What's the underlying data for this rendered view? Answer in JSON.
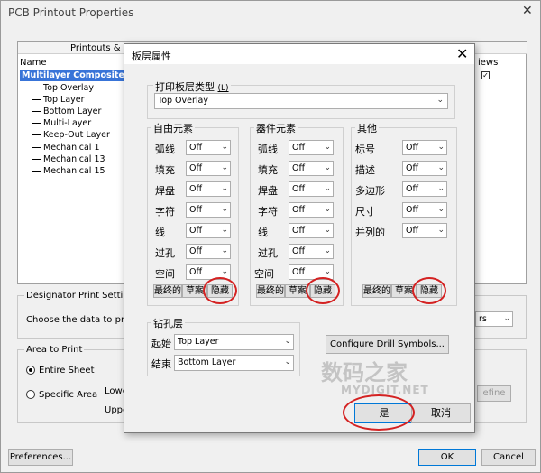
{
  "background_window": {
    "title": "PCB Printout Properties",
    "tree": {
      "col_printouts": "Printouts & Lay",
      "col_name": "Name",
      "col_views": "iews",
      "root": "Multilayer Composite Pr",
      "items": [
        "Top Overlay",
        "Top Layer",
        "Bottom Layer",
        "Multi-Layer",
        "Keep-Out Layer",
        "Mechanical 1",
        "Mechanical 13",
        "Mechanical 15"
      ]
    },
    "designator_group": "Designator Print Settings",
    "choose_label": "Choose the data to print",
    "right_select_fragment": "rs",
    "area_group": "Area to Print",
    "radio_entire": "Entire Sheet",
    "radio_specific": "Specific Area",
    "lower_label": "Lower",
    "upper_label": "Uppe",
    "define_button": "efine",
    "preferences_button": "Preferences...",
    "ok_button": "OK",
    "cancel_button": "Cancel"
  },
  "dialog": {
    "title": "板层属性",
    "layer_type_group": "打印板层类型",
    "layer_type_hotkey": "(L)",
    "layer_type_value": "Top Overlay",
    "free_group": "自由元素",
    "component_group": "器件元素",
    "other_group": "其他",
    "free_rows": [
      {
        "label": "弧线",
        "value": "Off"
      },
      {
        "label": "填充",
        "value": "Off"
      },
      {
        "label": "焊盘",
        "value": "Off"
      },
      {
        "label": "字符",
        "value": "Off"
      },
      {
        "label": "线",
        "value": "Off"
      },
      {
        "label": "过孔",
        "value": "Off"
      },
      {
        "label": "空间",
        "value": "Off"
      }
    ],
    "component_rows": [
      {
        "label": "弧线",
        "value": "Off"
      },
      {
        "label": "填充",
        "value": "Off"
      },
      {
        "label": "焊盘",
        "value": "Off"
      },
      {
        "label": "字符",
        "value": "Off"
      },
      {
        "label": "线",
        "value": "Off"
      },
      {
        "label": "过孔",
        "value": "Off"
      },
      {
        "label": "空间",
        "value": "Off"
      }
    ],
    "other_rows": [
      {
        "label": "标号",
        "value": "Off"
      },
      {
        "label": "描述",
        "value": "Off"
      },
      {
        "label": "多边形",
        "value": "Off"
      },
      {
        "label": "尺寸",
        "value": "Off"
      },
      {
        "label": "并列的",
        "value": "Off"
      }
    ],
    "final_button": "最终的",
    "draft_button": "草案",
    "hide_button": "隐藏",
    "drill_group": "钻孔层",
    "start_label": "起始",
    "start_value": "Top Layer",
    "end_label": "结束",
    "end_value": "Bottom Layer",
    "configure_drill": "Configure Drill Symbols...",
    "yes_button": "是",
    "cancel_button": "取消"
  },
  "watermark": {
    "cn": "数码之家",
    "en": "MYDIGIT.NET"
  },
  "colors": {
    "selection": "#3874d8",
    "highlight_ring": "#d42222",
    "focus_border": "#0078d7"
  }
}
